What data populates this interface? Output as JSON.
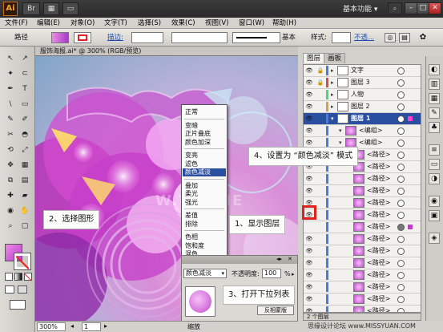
{
  "app": {
    "logo": "Ai",
    "workspace": "基本功能 ▾"
  },
  "window_buttons": [
    "–",
    "□",
    "✕"
  ],
  "menu": [
    "文件(F)",
    "编辑(E)",
    "对象(O)",
    "文字(T)",
    "选择(S)",
    "效果(C)",
    "视图(V)",
    "窗口(W)",
    "帮助(H)"
  ],
  "control_bar": {
    "selection_label": "路径",
    "stroke_label": "描边:",
    "style_label": "基本",
    "styles_label": "样式:",
    "opacity_link": "不透..."
  },
  "document_tab": "服饰海报.ai* @ 300% (RGB/预览)",
  "panel_tabs": [
    "图层",
    "画板"
  ],
  "layers": [
    {
      "name": "文字",
      "indent": 0,
      "kind": "layer",
      "color": "#4a7bd6"
    },
    {
      "name": "图层 3",
      "indent": 0,
      "kind": "layer",
      "color": "#d64a4a"
    },
    {
      "name": "人物",
      "indent": 0,
      "kind": "layer",
      "color": "#4ad67a"
    },
    {
      "name": "图层 2",
      "indent": 0,
      "kind": "layer",
      "color": "#d6a04a"
    },
    {
      "name": "图层 1",
      "indent": 0,
      "kind": "active",
      "color": "#4a7bd6"
    },
    {
      "name": "<编组>",
      "indent": 1,
      "kind": "group",
      "color": "#4a7bd6"
    },
    {
      "name": "<编组>",
      "indent": 1,
      "kind": "group",
      "color": "#4a7bd6"
    },
    {
      "name": "<路径>",
      "indent": 2,
      "kind": "path",
      "color": "#4a7bd6"
    },
    {
      "name": "<路径>",
      "indent": 2,
      "kind": "path",
      "color": "#4a7bd6"
    },
    {
      "name": "<路径>",
      "indent": 2,
      "kind": "path",
      "color": "#4a7bd6"
    },
    {
      "name": "<路径>",
      "indent": 2,
      "kind": "path",
      "color": "#4a7bd6"
    },
    {
      "name": "<路径>",
      "indent": 2,
      "kind": "path",
      "color": "#4a7bd6"
    },
    {
      "name": "<路径>",
      "indent": 2,
      "kind": "path",
      "color": "#4a7bd6"
    },
    {
      "name": "<路径>",
      "indent": 2,
      "kind": "selected",
      "color": "#4a7bd6"
    },
    {
      "name": "<路径>",
      "indent": 2,
      "kind": "path",
      "color": "#4a7bd6"
    },
    {
      "name": "<路径>",
      "indent": 2,
      "kind": "path",
      "color": "#4a7bd6"
    },
    {
      "name": "<路径>",
      "indent": 2,
      "kind": "path",
      "color": "#4a7bd6"
    },
    {
      "name": "<路径>",
      "indent": 2,
      "kind": "path",
      "color": "#4a7bd6"
    },
    {
      "name": "<路径>",
      "indent": 2,
      "kind": "path",
      "color": "#4a7bd6"
    },
    {
      "name": "<路径>",
      "indent": 2,
      "kind": "path",
      "color": "#4a7bd6"
    },
    {
      "name": "<路径>",
      "indent": 2,
      "kind": "path",
      "color": "#4a7bd6"
    }
  ],
  "layers_footer": "2 个图层",
  "blend_menu": {
    "groups": [
      [
        "正常"
      ],
      [
        "变暗",
        "正片叠底",
        "颜色加深"
      ],
      [
        "变亮",
        "滤色",
        "颜色减淡"
      ],
      [
        "叠加",
        "柔光",
        "强光"
      ],
      [
        "差值",
        "排除"
      ],
      [
        "色相",
        "饱和度",
        "混色",
        "明度"
      ]
    ],
    "selected": "颜色减淡"
  },
  "transparency_panel": {
    "blend_mode": "颜色减淡",
    "opacity_label": "不透明度:",
    "opacity_value": "100",
    "opacity_unit": "%",
    "make_mask": "反相蒙版"
  },
  "callouts": {
    "step1": "1、显示图层",
    "step2": "2、选择图形",
    "step3": "3、打开下拉列表",
    "step4": "4、设置为 “颜色减淡” 模式"
  },
  "status": {
    "zoom": "300%",
    "page": "1",
    "mode": "缩放"
  },
  "watermark": "思缘设计论坛 www.MISSYUAN.COM",
  "canvas_watermark": "W.TLVINE"
}
